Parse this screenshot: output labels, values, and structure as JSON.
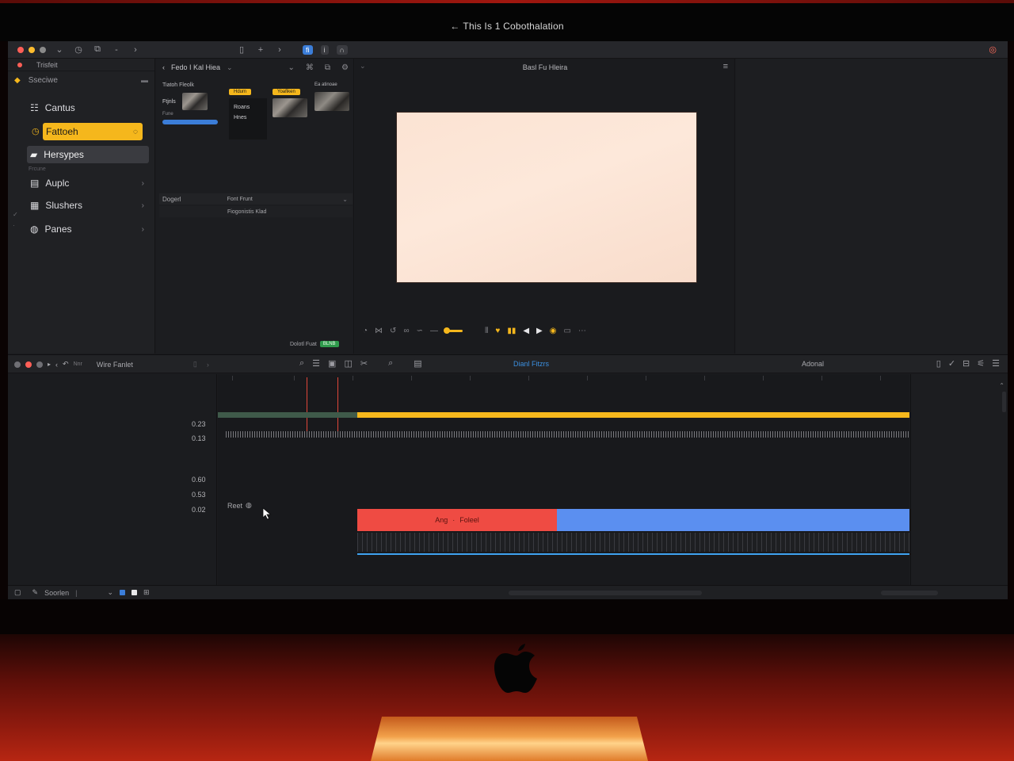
{
  "window": {
    "title": "This Is 1 Cobothalation",
    "title_arrow": "←"
  },
  "toolbar": {
    "icons": [
      "chevron-down-icon",
      "clock-icon",
      "copy-icon",
      "minus-icon",
      "forward-icon",
      "doc-icon",
      "plus-icon",
      "forward-icon"
    ],
    "btn_blue": "fi",
    "btn_grey1": "i",
    "btn_grey2": "∩"
  },
  "sidebar": {
    "tab_label": "Trisfeit",
    "section_label": "Sseciwe",
    "items": [
      {
        "label": "Cantus",
        "icon": "grid-icon"
      },
      {
        "label": "Fattoeh",
        "icon": "clock-icon",
        "active": true
      },
      {
        "label": "Hersypes",
        "icon": "folder-icon",
        "selected": true
      },
      {
        "label": "Auplc",
        "icon": "audio-icon"
      },
      {
        "label": "Slushers",
        "icon": "stack-icon"
      },
      {
        "label": "Panes",
        "icon": "panes-icon"
      }
    ],
    "sub_label": "Frcune"
  },
  "browser": {
    "header": "Fedo I Kal Hiea",
    "col1_label": "Tiatoh Fleolk",
    "col1_text": "Ftjnls",
    "col1_text2": "Fune",
    "col2_tag": "Hdum",
    "col2_line1": "Roans",
    "col2_line2": "Hnes",
    "col3_tag": "Yoafiken",
    "col4_label": "Ea atinoae",
    "row1_left": "Dogerl",
    "row1_right": "Font Frunt",
    "row2": "Fiogonistis Klad",
    "footer_label": "Dolotl Fuat",
    "footer_badge": "BLNB"
  },
  "viewer": {
    "title": "Basl Fu Hleira"
  },
  "timeline": {
    "tab_label": "Wire Fanlet",
    "left_small": "Nnr",
    "center_label": "Dianl Fitzrs",
    "right_label": "Adonal",
    "track_numbers_top": [
      "0.23",
      "0.13"
    ],
    "track_numbers_bottom": [
      "0.60",
      "0.53",
      "0.02"
    ],
    "reset_label": "Reet",
    "red_clip_left": "Ang",
    "red_clip_right": "Foleel"
  },
  "status": {
    "label": "Soorlen"
  },
  "colors": {
    "accent_yellow": "#f5b71c",
    "clip_red": "#ef4b43",
    "clip_blue": "#5b8ff0",
    "canvas": "#fbe3d3",
    "frame_red": "#a0170f"
  }
}
